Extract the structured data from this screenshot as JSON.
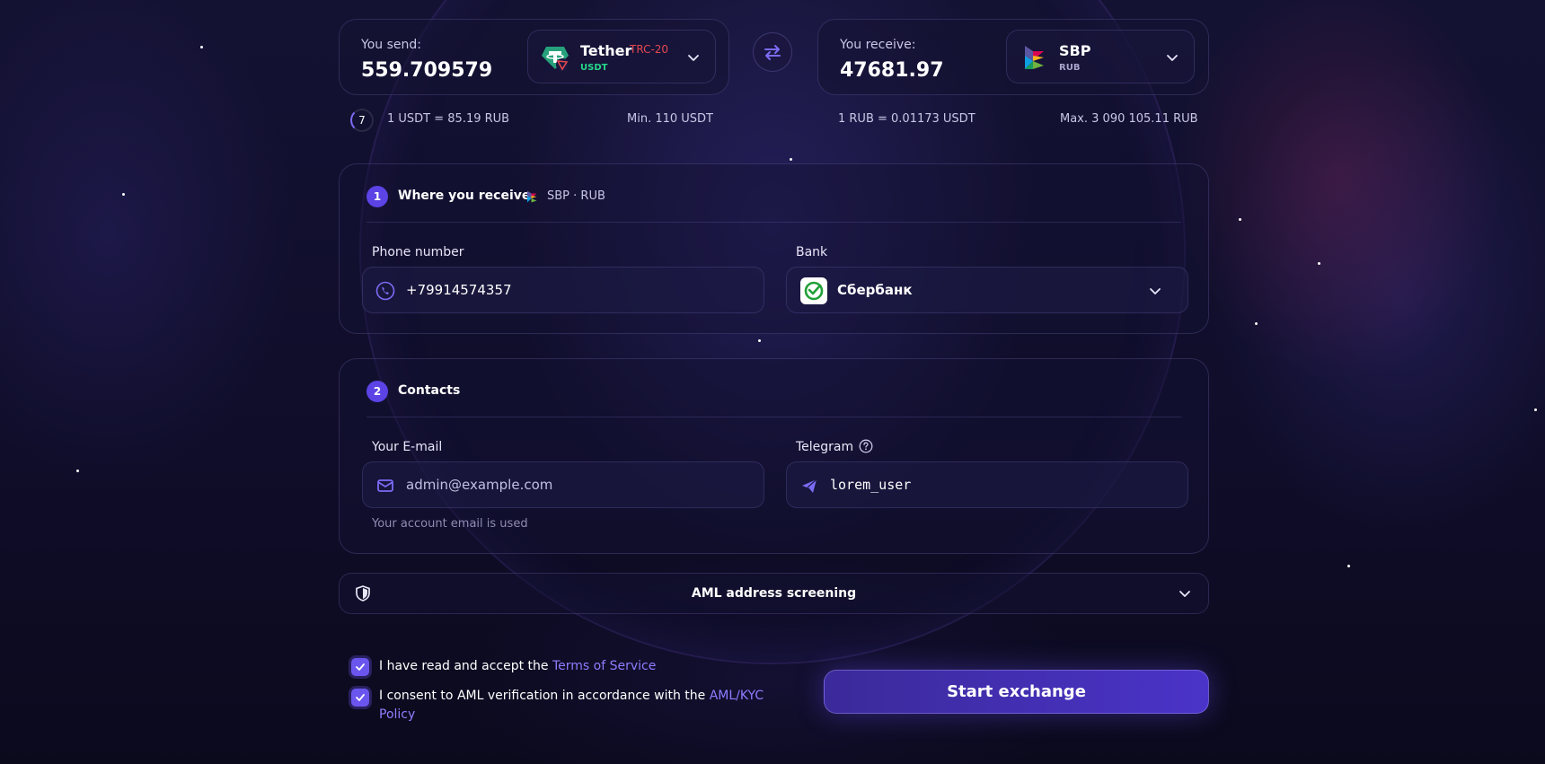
{
  "send": {
    "label": "You send:",
    "amount": "559.709579",
    "currency_name": "Tether",
    "currency_network": "TRC-20",
    "currency_code": "USDT",
    "icon": "tether-icon"
  },
  "receive": {
    "label": "You receive:",
    "amount": "47681.97",
    "currency_name": "SBP",
    "currency_code": "RUB",
    "icon": "sbp-icon"
  },
  "rates": {
    "timer": "7",
    "send_rate": "1 USDT = 85.19 RUB",
    "send_min": "Min. 110 USDT",
    "receive_rate": "1 RUB = 0.01173 USDT",
    "receive_max": "Max. 3 090 105.11 RUB"
  },
  "where": {
    "step": "1",
    "title": "Where you receive",
    "method": "SBP · RUB",
    "phone_label": "Phone number",
    "phone_value": "+79914574357",
    "bank_label": "Bank",
    "bank_value": "Сбербанк"
  },
  "contacts": {
    "step": "2",
    "title": "Contacts",
    "email_label": "Your E-mail",
    "email_value": "admin@example.com",
    "email_hint": "Your account email is used",
    "telegram_label": "Telegram",
    "telegram_value": "lorem_user"
  },
  "aml": {
    "title": "AML address screening"
  },
  "agreements": {
    "terms_prefix": "I have read and accept the",
    "terms_link": "Terms of Service",
    "aml_prefix": "I consent to AML verification in accordance with the",
    "aml_link_1": "AML/KYC",
    "aml_link_2": "Policy"
  },
  "actions": {
    "start_label": "Start exchange"
  },
  "colors": {
    "accent": "#5b43e6",
    "link": "#8d7dff",
    "background": "#0d0c22",
    "network_red": "#e2474d"
  }
}
